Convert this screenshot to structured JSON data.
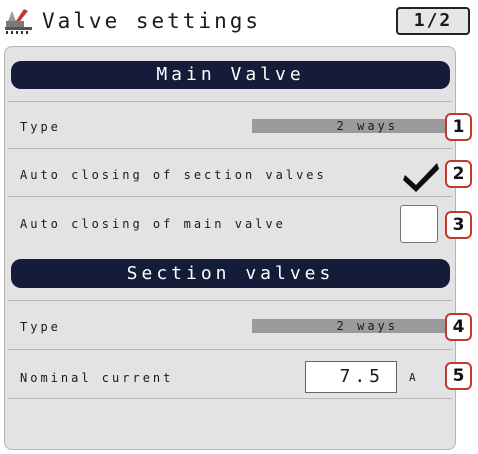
{
  "header": {
    "title": "Valve settings",
    "page_indicator": "1/2",
    "app_icon": "sprayer-settings-icon"
  },
  "main_valve": {
    "section_title": "Main Valve",
    "type": {
      "label": "Type",
      "value": "2 ways"
    },
    "auto_close_sections": {
      "label": "Auto closing of section valves",
      "checked": true
    },
    "auto_close_main": {
      "label": "Auto closing of main valve",
      "checked": false
    }
  },
  "section_valves": {
    "section_title": "Section valves",
    "type": {
      "label": "Type",
      "value": "2 ways"
    },
    "nominal_current": {
      "label": "Nominal current",
      "value": "7.5",
      "unit": "A"
    }
  },
  "callouts": [
    "1",
    "2",
    "3",
    "4",
    "5"
  ],
  "colors": {
    "section_header_bg": "#141c3a",
    "panel_bg": "#e3e3e3",
    "value_bar": "#9b9b9b",
    "callout_border": "#c0392b"
  }
}
